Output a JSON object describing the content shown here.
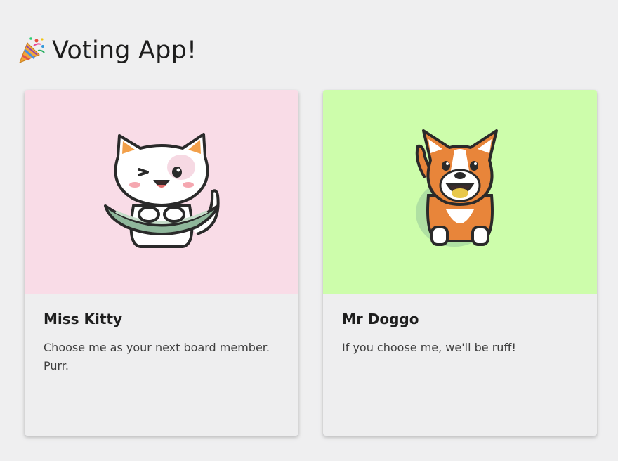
{
  "header": {
    "title": "Voting App!",
    "icon": "party-popper-icon"
  },
  "candidates": [
    {
      "name": "Miss Kitty",
      "description": "Choose me as your next board member. Purr.",
      "image_icon": "cat-icon",
      "background_color": "#f9dce7"
    },
    {
      "name": "Mr Doggo",
      "description": "If you choose me, we'll be ruff!",
      "image_icon": "dog-icon",
      "background_color": "#cdfdab"
    }
  ],
  "colors": {
    "page_background": "#efeff0",
    "card_background": "#eeeeef"
  }
}
